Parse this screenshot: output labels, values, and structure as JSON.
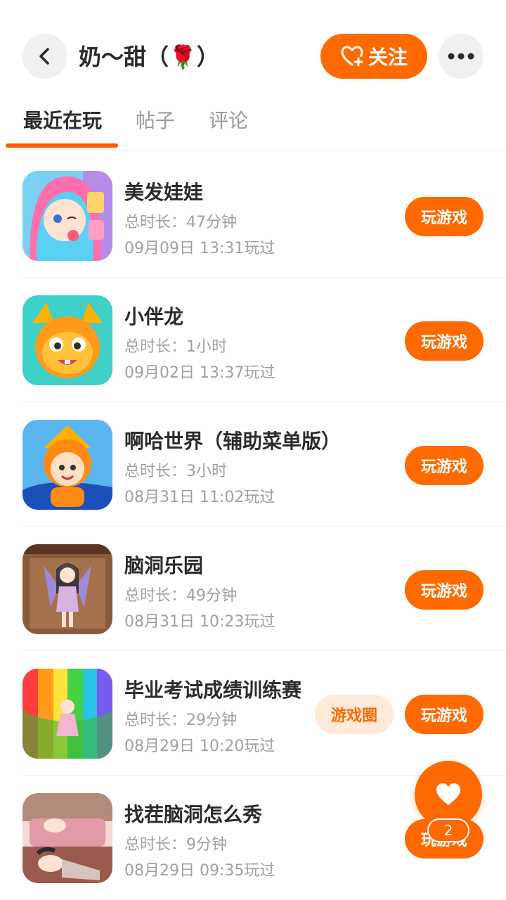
{
  "header": {
    "username": "奶～甜（🌹）",
    "follow_label": "关注"
  },
  "tabs": [
    {
      "label": "最近在玩",
      "active": true
    },
    {
      "label": "帖子",
      "active": false
    },
    {
      "label": "评论",
      "active": false
    }
  ],
  "games": [
    {
      "title": "美发娃娃",
      "duration": "总时长：47分钟",
      "last_played": "09月09日 13:31玩过",
      "play_label": "玩游戏",
      "icon": "doll-hair-icon"
    },
    {
      "title": "小伴龙",
      "duration": "总时长：1小时",
      "last_played": "09月02日 13:37玩过",
      "play_label": "玩游戏",
      "icon": "dragon-icon"
    },
    {
      "title": "啊哈世界（辅助菜单版）",
      "duration": "总时长：3小时",
      "last_played": "08月31日 11:02玩过",
      "play_label": "玩游戏",
      "icon": "tiger-kid-icon"
    },
    {
      "title": "脑洞乐园",
      "duration": "总时长：49分钟",
      "last_played": "08月31日 10:23玩过",
      "play_label": "玩游戏",
      "icon": "girl-room-icon"
    },
    {
      "title": "毕业考试成绩训练赛",
      "duration": "总时长：29分钟",
      "last_played": "08月29日 10:20玩过",
      "play_label": "玩游戏",
      "circle_label": "游戏圈",
      "icon": "rainbow-stairs-icon"
    },
    {
      "title": "找茬脑洞怎么秀",
      "duration": "总时长：9分钟",
      "last_played": "08月29日 09:35玩过",
      "play_label": "玩游戏",
      "icon": "bedroom-scene-icon"
    }
  ],
  "like": {
    "count": "2"
  },
  "colors": {
    "accent": "#ff6a00",
    "accent_light": "#ffe9d9",
    "text": "#2b2b2b",
    "muted": "#a0a0a0"
  }
}
